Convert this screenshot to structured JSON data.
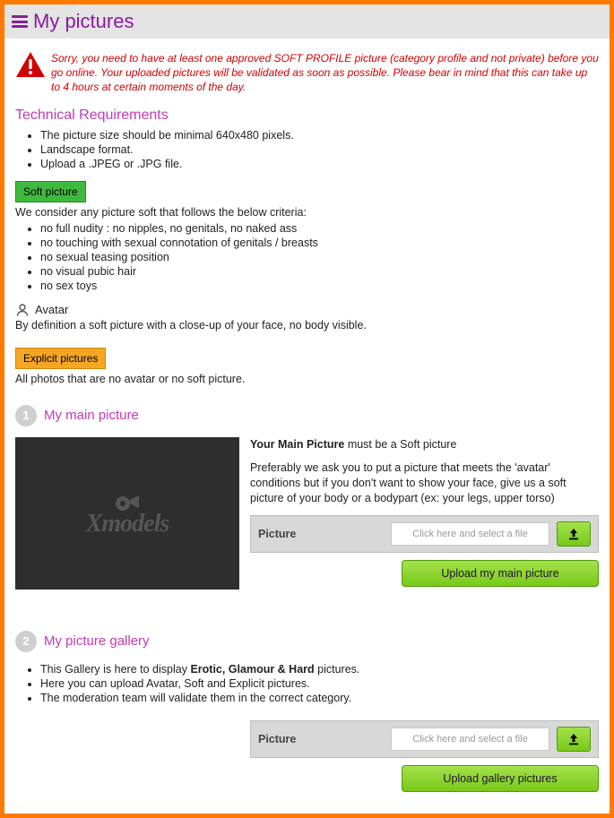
{
  "header": {
    "title": "My pictures"
  },
  "warning": {
    "text": "Sorry, you need to have at least one approved SOFT PROFILE picture (category profile and not private) before you go online. Your uploaded pictures will be validated as soon as possible. Please bear in mind that this can take up to 4 hours at certain moments of the day."
  },
  "tech": {
    "heading": "Technical Requirements",
    "items": [
      "The picture size should be minimal 640x480 pixels.",
      "Landscape format.",
      "Upload a .JPEG or .JPG file."
    ]
  },
  "soft": {
    "tag": "Soft picture",
    "intro": "We consider any picture soft that follows the below criteria:",
    "items": [
      "no full nudity : no nipples, no genitals, no naked ass",
      "no touching with sexual connotation of genitals / breasts",
      "no sexual teasing position",
      "no visual pubic hair",
      "no sex toys"
    ]
  },
  "avatar": {
    "label": "Avatar",
    "desc": "By definition a soft picture with a close-up of your face, no body visible."
  },
  "explicit": {
    "tag": "Explicit pictures",
    "desc": "All photos that are no avatar or no soft picture."
  },
  "step1": {
    "num": "1",
    "title": "My main picture",
    "placeholder_brand": "Xmodels",
    "heading_bold": "Your Main Picture",
    "heading_rest": " must be a Soft picture",
    "paragraph": "Preferably we ask you to put a picture that meets the 'avatar' conditions but if you don't want to show your face, give us a soft picture of your body or a bodypart (ex: your legs, upper torso)",
    "picker_label": "Picture",
    "picker_placeholder": "Click here and select a file",
    "upload_btn": "Upload my main picture"
  },
  "step2": {
    "num": "2",
    "title": "My picture gallery",
    "items_pre": "This Gallery is here to display ",
    "items_bold": "Erotic, Glamour & Hard",
    "items_post": " pictures.",
    "item2": "Here you can upload Avatar, Soft and Explicit pictures.",
    "item3": "The moderation team will validate them in the correct category.",
    "picker_label": "Picture",
    "picker_placeholder": "Click here and select a file",
    "upload_btn": "Upload gallery pictures"
  }
}
